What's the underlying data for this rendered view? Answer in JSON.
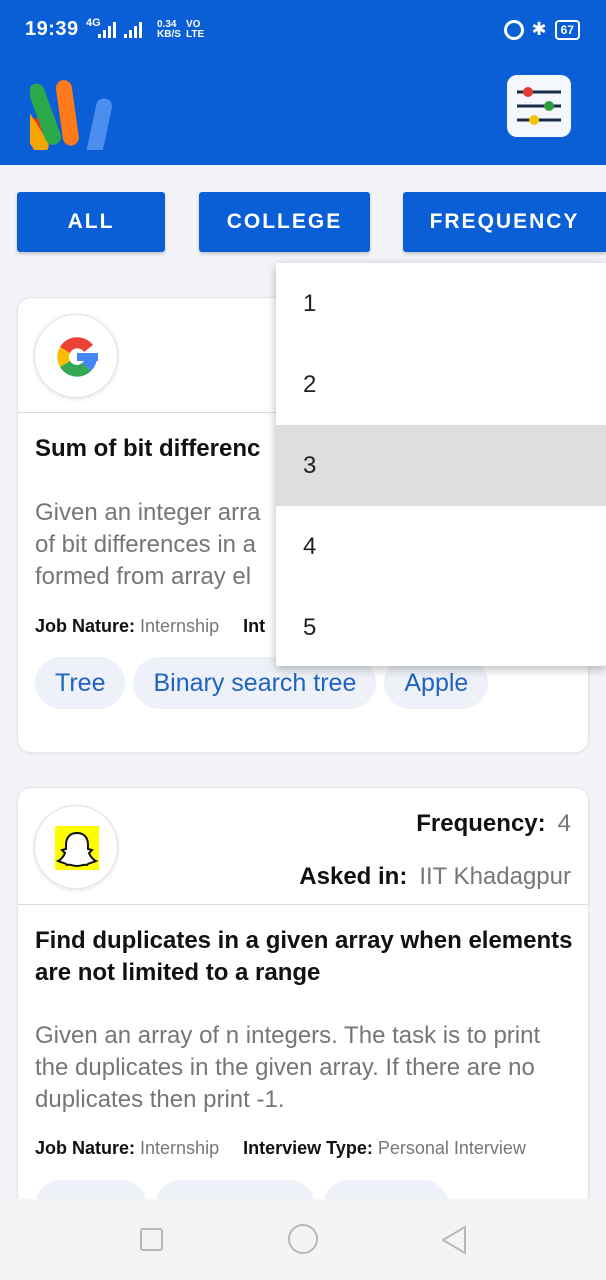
{
  "status_bar": {
    "time": "19:39",
    "network": "4G",
    "speed_value": "0.34",
    "speed_unit": "KB/S",
    "volte_top": "VO",
    "volte_bottom": "LTE",
    "battery": "67"
  },
  "filters": [
    {
      "label": "ALL"
    },
    {
      "label": "COLLEGE"
    },
    {
      "label": "FREQUENCY"
    }
  ],
  "dropdown": {
    "options": [
      "1",
      "2",
      "3",
      "4",
      "5"
    ],
    "selected": "3"
  },
  "cards": [
    {
      "company_icon": "google-logo",
      "title": "Sum of bit differenc",
      "description_lines": [
        "Given an integer arra",
        "of bit differences in a",
        "formed from array el"
      ],
      "job_nature_label": "Job Nature:",
      "job_nature_value": "Internship",
      "interview_type_label": "Int",
      "tags": [
        "Tree",
        "Binary search tree",
        "Apple"
      ]
    },
    {
      "company_icon": "snapchat-logo",
      "frequency_label": "Frequency:",
      "frequency_value": "4",
      "asked_in_label": "Asked in:",
      "asked_in_value": "IIT Khadagpur",
      "title": "Find duplicates in a given array when elements are not limited to a range",
      "description": "Given an array of n integers. The task is to print the duplicates in the given array. If there are no duplicates then print -1.",
      "job_nature_label": "Job Nature:",
      "job_nature_value": "Internship",
      "interview_type_label": "Interview Type:",
      "interview_type_value": "Personal Interview"
    }
  ],
  "colors": {
    "primary": "#0a5fd6",
    "tag_text": "#1e63c4",
    "tag_bg": "#eef2f8",
    "selected_option_bg": "#dedede"
  }
}
